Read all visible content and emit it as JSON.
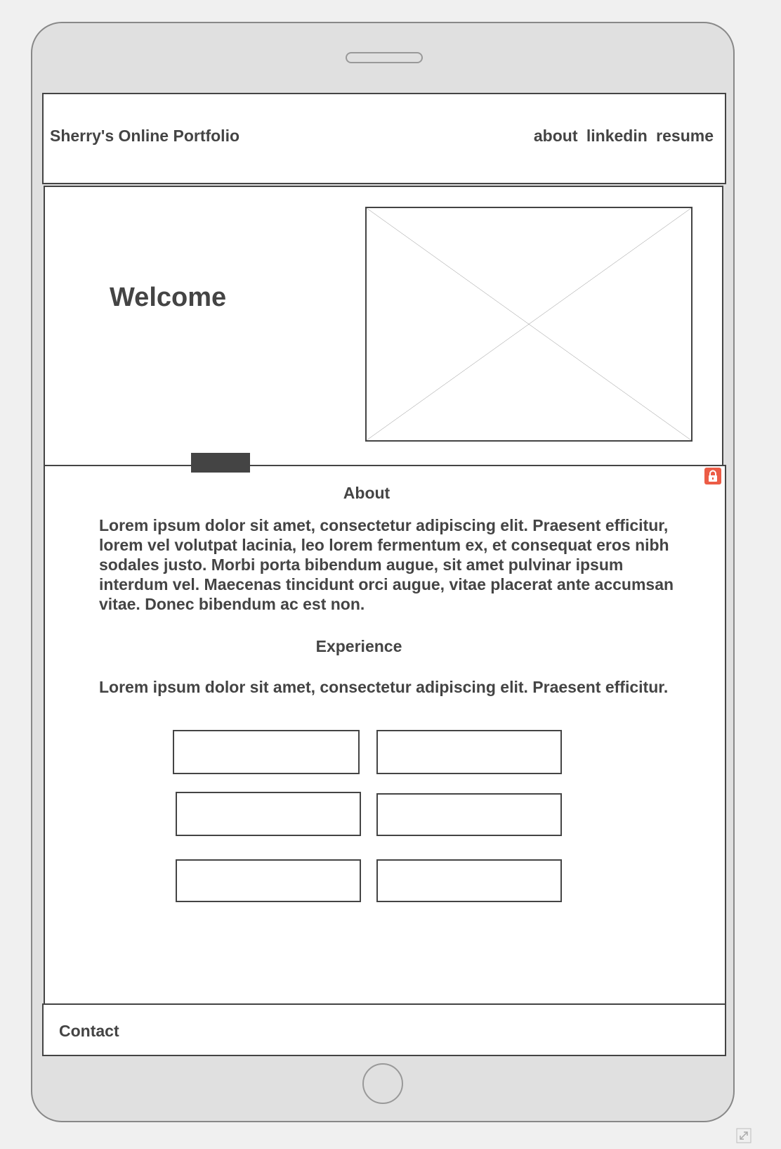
{
  "header": {
    "title": "Sherry's Online Portfolio",
    "nav": [
      "about",
      "linkedin",
      "resume"
    ]
  },
  "hero": {
    "heading": "Welcome",
    "image_placeholder": "image-placeholder"
  },
  "about": {
    "heading": "About",
    "body": "Lorem ipsum dolor sit amet, consectetur adipiscing elit. Praesent efficitur, lorem vel volutpat lacinia, leo lorem fermentum ex, et consequat eros nibh sodales justo. Morbi porta bibendum augue, sit amet pulvinar ipsum interdum vel. Maecenas tincidunt orci augue, vitae placerat ante accumsan vitae. Donec bibendum ac est non."
  },
  "experience": {
    "heading": "Experience",
    "body": "Lorem ipsum dolor sit amet, consectetur adipiscing elit. Praesent efficitur."
  },
  "footer": {
    "contact": "Contact"
  },
  "icons": {
    "lock": "lock-icon",
    "expand": "expand-icon"
  },
  "colors": {
    "lock_badge": "#ec5c46",
    "frame": "#e0e0e0",
    "text": "#444444"
  }
}
